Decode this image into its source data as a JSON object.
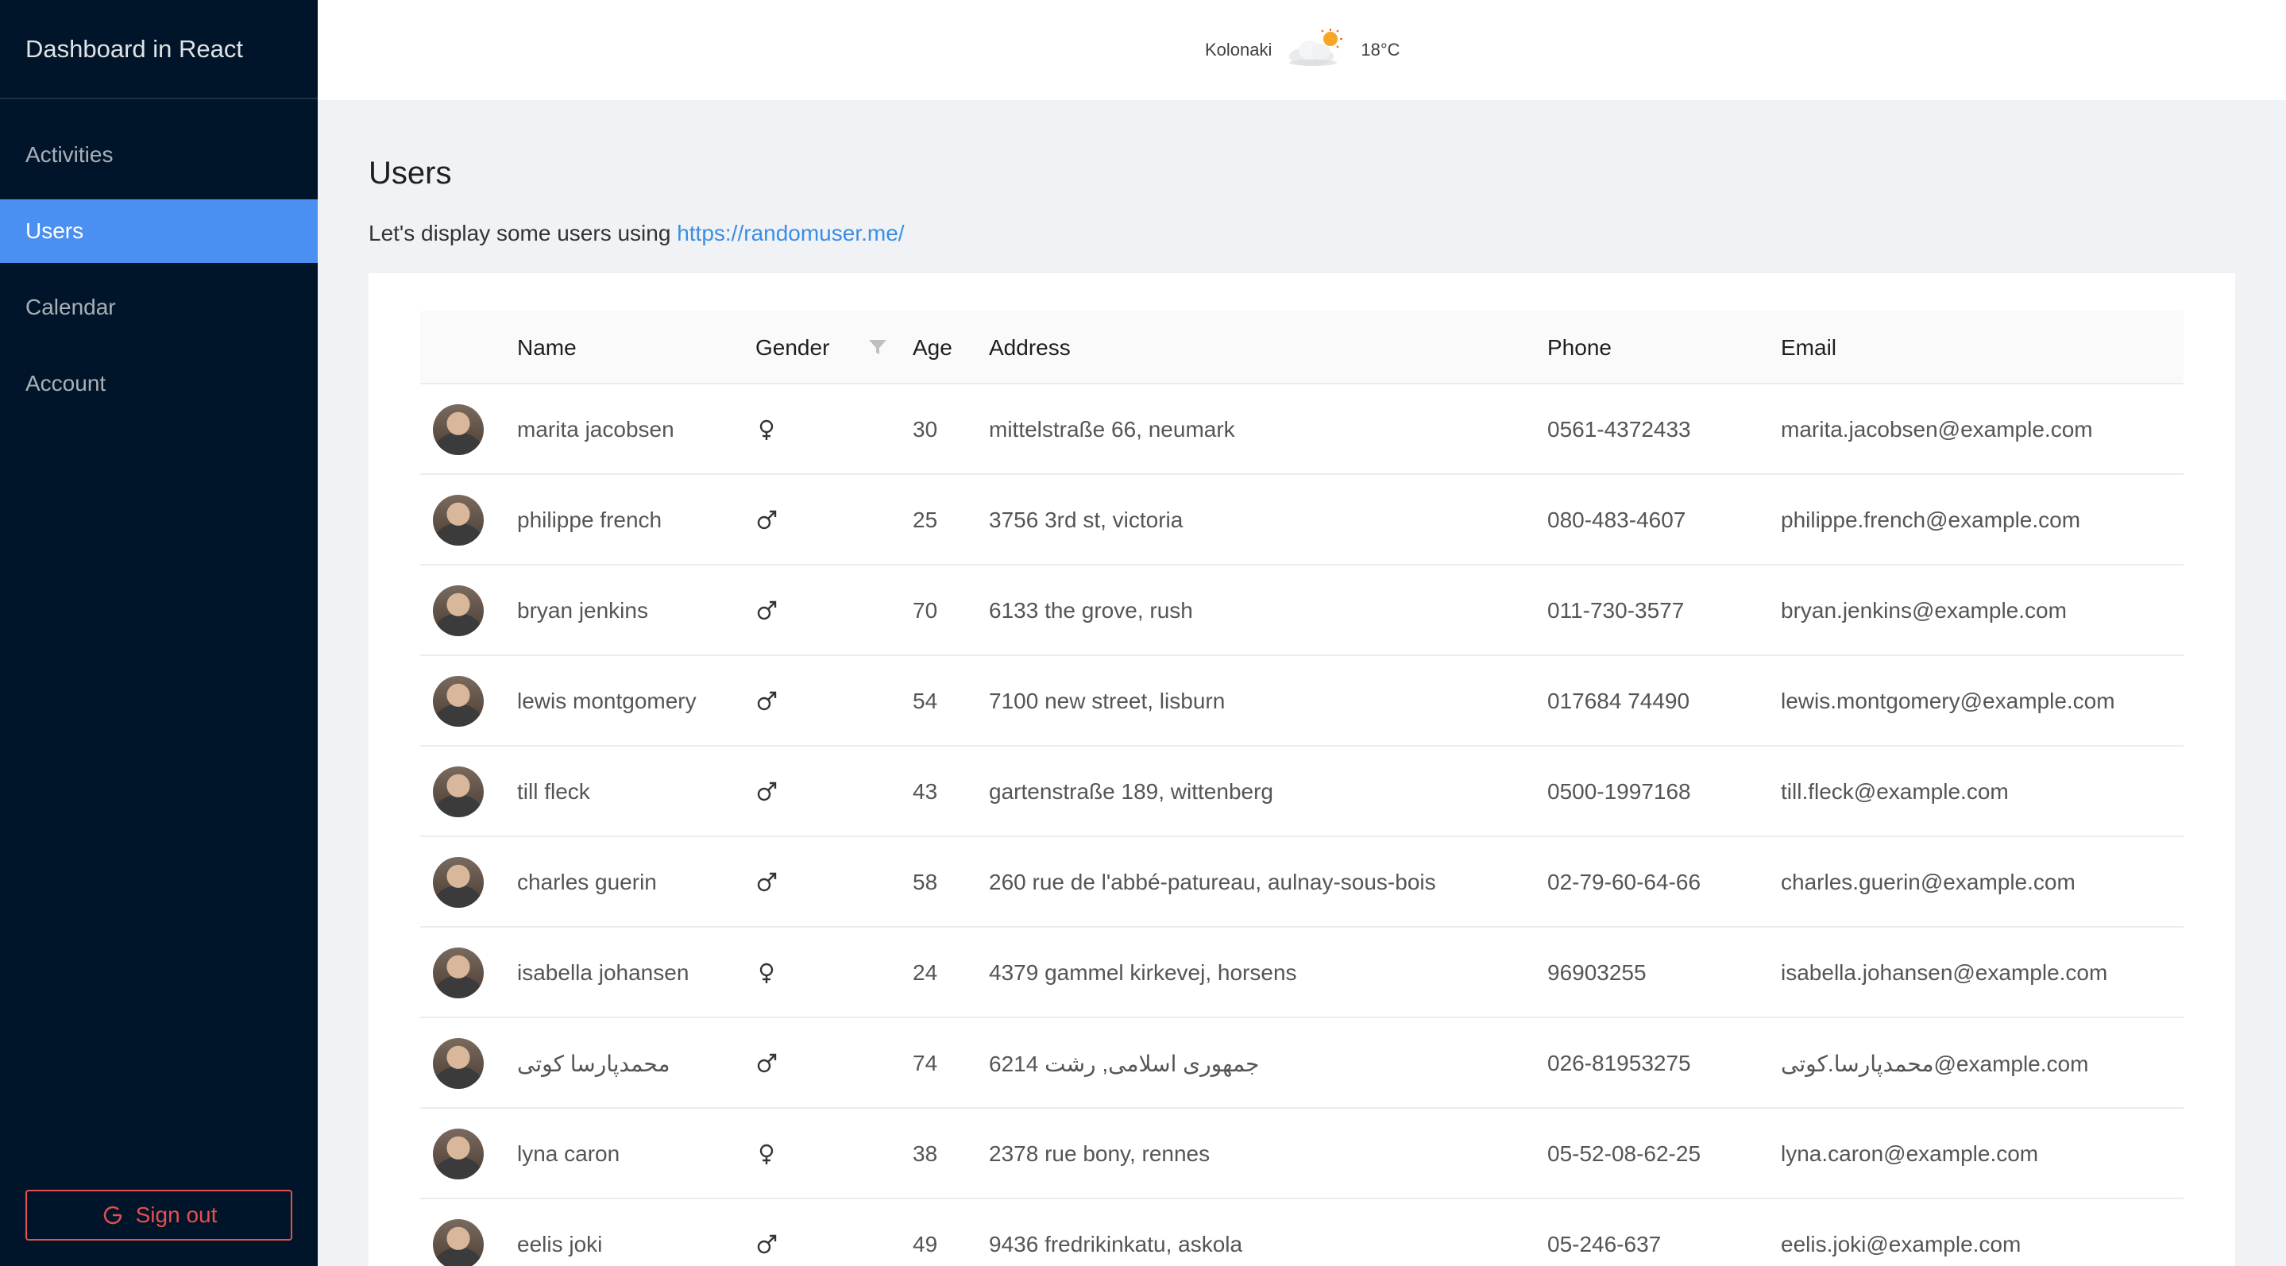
{
  "sidebar": {
    "brand": "Dashboard in React",
    "items": [
      {
        "label": "Activities",
        "active": false
      },
      {
        "label": "Users",
        "active": true
      },
      {
        "label": "Calendar",
        "active": false
      },
      {
        "label": "Account",
        "active": false
      }
    ],
    "signout_label": "Sign out"
  },
  "header": {
    "location": "Kolonaki",
    "temperature": "18°C",
    "weather_icon": "partly-cloudy-icon"
  },
  "main": {
    "title": "Users",
    "intro_text": "Let's display some users using ",
    "intro_link": "https://randomuser.me/"
  },
  "table": {
    "columns": {
      "name": "Name",
      "gender": "Gender",
      "age": "Age",
      "address": "Address",
      "phone": "Phone",
      "email": "Email"
    },
    "rows": [
      {
        "name": "marita jacobsen",
        "gender": "female",
        "age": "30",
        "address": "mittelstraße 66, neumark",
        "phone": "0561-4372433",
        "email": "marita.jacobsen@example.com"
      },
      {
        "name": "philippe french",
        "gender": "male",
        "age": "25",
        "address": "3756 3rd st, victoria",
        "phone": "080-483-4607",
        "email": "philippe.french@example.com"
      },
      {
        "name": "bryan jenkins",
        "gender": "male",
        "age": "70",
        "address": "6133 the grove, rush",
        "phone": "011-730-3577",
        "email": "bryan.jenkins@example.com"
      },
      {
        "name": "lewis montgomery",
        "gender": "male",
        "age": "54",
        "address": "7100 new street, lisburn",
        "phone": "017684 74490",
        "email": "lewis.montgomery@example.com"
      },
      {
        "name": "till fleck",
        "gender": "male",
        "age": "43",
        "address": "gartenstraße 189, wittenberg",
        "phone": "0500-1997168",
        "email": "till.fleck@example.com"
      },
      {
        "name": "charles guerin",
        "gender": "male",
        "age": "58",
        "address": "260 rue de l'abbé-patureau, aulnay-sous-bois",
        "phone": "02-79-60-64-66",
        "email": "charles.guerin@example.com"
      },
      {
        "name": "isabella johansen",
        "gender": "female",
        "age": "24",
        "address": "4379 gammel kirkevej, horsens",
        "phone": "96903255",
        "email": "isabella.johansen@example.com"
      },
      {
        "name": "محمدپارسا کوتی",
        "gender": "male",
        "age": "74",
        "address": "6214 جمهوری اسلامی, رشت",
        "phone": "026-81953275",
        "email": "محمدپارسا.کوتی@example.com"
      },
      {
        "name": "lyna caron",
        "gender": "female",
        "age": "38",
        "address": "2378 rue bony, rennes",
        "phone": "05-52-08-62-25",
        "email": "lyna.caron@example.com"
      },
      {
        "name": "eelis joki",
        "gender": "male",
        "age": "49",
        "address": "9436 fredrikinkatu, askola",
        "phone": "05-246-637",
        "email": "eelis.joki@example.com"
      }
    ]
  },
  "colors": {
    "sidebar_bg": "#001529",
    "active_item": "#4a8ff1",
    "signout": "#ea4d4f",
    "link": "#3a8ee6",
    "page_bg": "#f0f2f5"
  }
}
